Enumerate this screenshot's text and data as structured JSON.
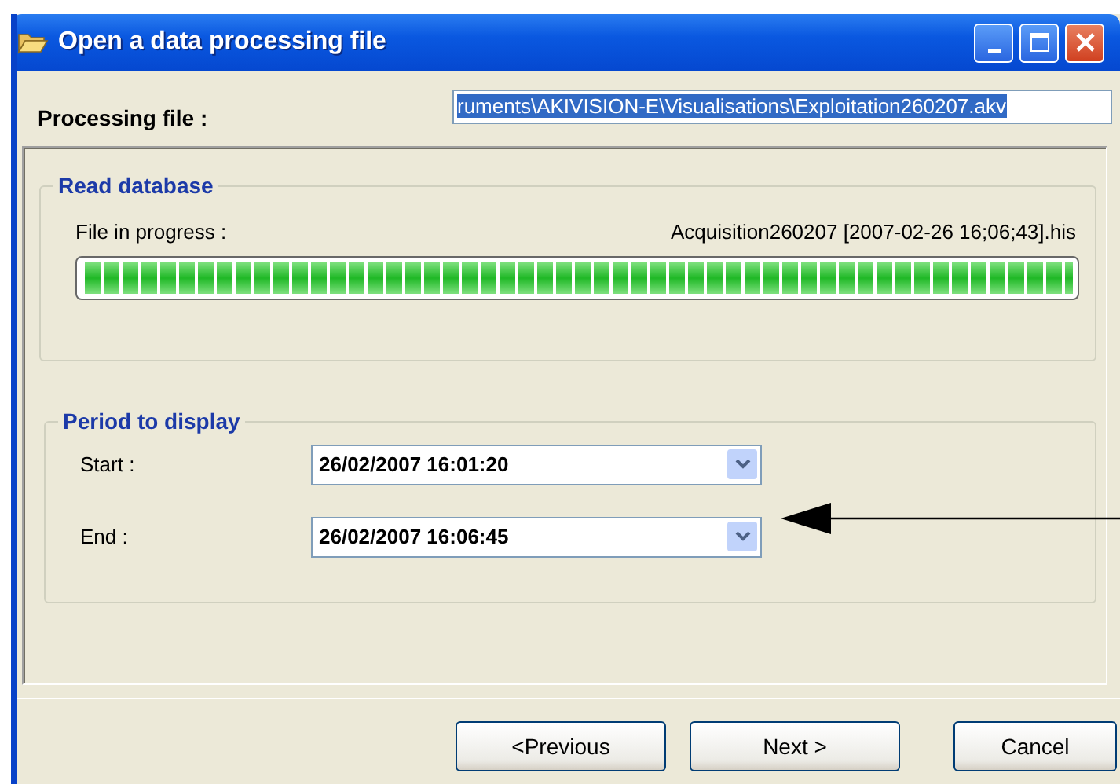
{
  "window": {
    "title": "Open a data processing file"
  },
  "processing_file": {
    "label": "Processing file :",
    "value": "ruments\\AKIVISION-E\\Visualisations\\Exploitation260207.akv",
    "selected": true
  },
  "read_database": {
    "title": "Read database",
    "label": "File in progress :",
    "file": "Acquisition260207 [2007-02-26 16;06;43].his",
    "level": 1
  },
  "period": {
    "title": "Period to display",
    "fields": [
      {
        "label": "Start :",
        "value": "26/02/2007 16:01:20"
      },
      {
        "label": "End :",
        "value": "26/02/2007 16:06:45"
      }
    ]
  },
  "buttons": [
    "<Previous",
    "Next >",
    "Cancel"
  ]
}
